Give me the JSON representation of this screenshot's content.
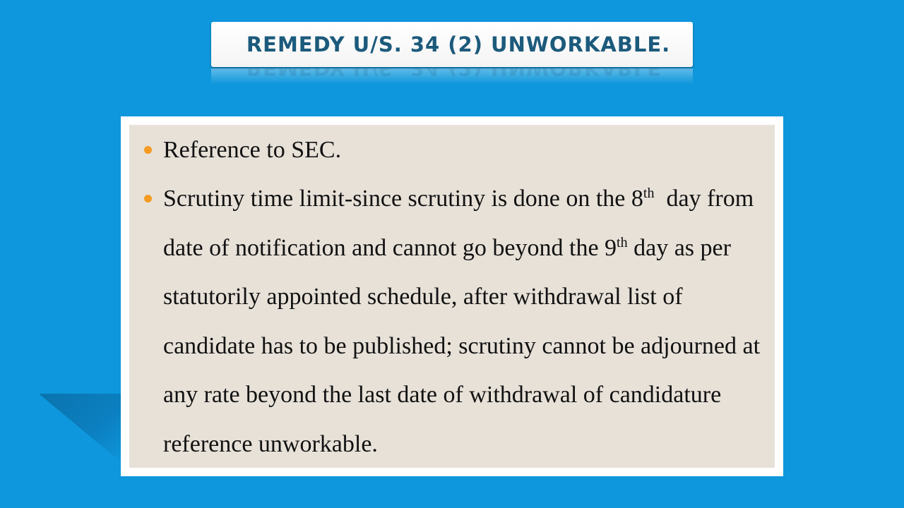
{
  "slide": {
    "title": "REMEDY U/S. 34 (2) UNWORKABLE.",
    "bullets": [
      {
        "text": "Reference to SEC."
      },
      {
        "part1": "Scrutiny time limit-since scrutiny is done on the 8",
        "sup1": "th",
        "part2": "  day from date of notification and cannot go beyond the 9",
        "sup2": "th",
        "part3": " day as per statutorily appointed schedule, after withdrawal list of candidate has to be published; scrutiny cannot be adjourned at any rate beyond the last date of withdrawal of candidature reference unworkable."
      }
    ]
  },
  "colors": {
    "background": "#0e97dc",
    "title_text": "#1c5a7c",
    "content_bg": "#e7e1d8",
    "bullet": "#f59a23"
  }
}
